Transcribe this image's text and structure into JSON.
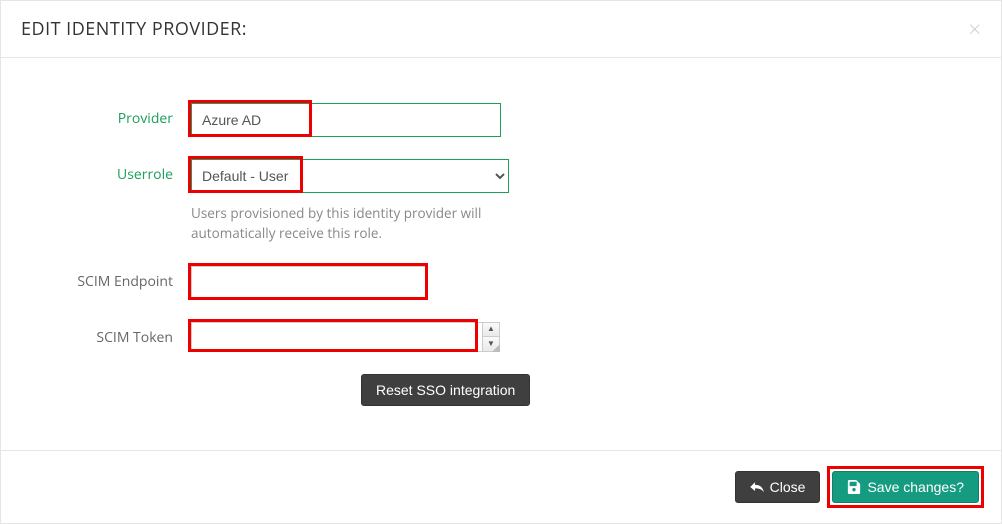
{
  "header": {
    "title": "EDIT IDENTITY PROVIDER:"
  },
  "form": {
    "provider": {
      "label": "Provider",
      "value": "Azure AD"
    },
    "userrole": {
      "label": "Userrole",
      "selected": "Default - User",
      "help": "Users provisioned by this identity provider will automatically receive this role."
    },
    "scim_endpoint": {
      "label": "SCIM Endpoint",
      "value": ""
    },
    "scim_token": {
      "label": "SCIM Token",
      "value": ""
    },
    "reset_label": "Reset SSO integration"
  },
  "footer": {
    "close_label": "Close",
    "save_label": "Save changes?"
  }
}
